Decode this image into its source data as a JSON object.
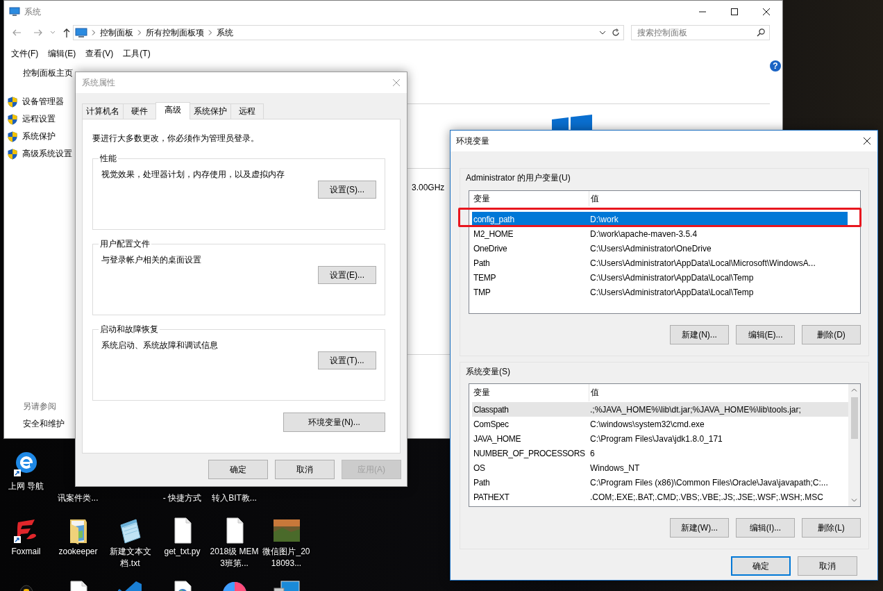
{
  "control_panel": {
    "title": "系统",
    "active": false,
    "breadcrumb": [
      "控制面板",
      "所有控制面板项",
      "系统"
    ],
    "search": {
      "placeholder": "搜索控制面板"
    },
    "menu": [
      "文件(F)",
      "编辑(E)",
      "查看(V)",
      "工具(T)"
    ],
    "help_button": "?",
    "home_link": "控制面板主页",
    "tasks": [
      "设备管理器",
      "远程设置",
      "系统保护",
      "高级系统设置"
    ],
    "see_also": {
      "heading": "另请参阅",
      "links": [
        "安全和维护"
      ]
    },
    "processor_speed": "3.00GHz"
  },
  "desktop": {
    "rows": [
      {
        "icons": [
          {
            "kind": "ie",
            "label": "上网 导航"
          },
          {
            "kind": "covered",
            "label": "讯案件类..."
          },
          {
            "kind": "covered"
          },
          {
            "kind": "covered",
            "label": "- 快捷方式"
          },
          {
            "kind": "covered",
            "label": "转入BIT教..."
          }
        ]
      },
      {
        "icons": [
          {
            "kind": "foxmail",
            "label": "Foxmail"
          },
          {
            "kind": "folder",
            "label": "zookeeper"
          },
          {
            "kind": "notepad",
            "label": "新建文本文档.txt"
          },
          {
            "kind": "file",
            "label": "get_txt.py"
          },
          {
            "kind": "file",
            "label": "2018级 MEM3班第..."
          },
          {
            "kind": "photo",
            "label": "微信图片_2018093..."
          }
        ]
      },
      {
        "icons": [
          {
            "kind": "qq"
          },
          {
            "kind": "file"
          },
          {
            "kind": "vscode"
          },
          {
            "kind": "html"
          },
          {
            "kind": "circle"
          },
          {
            "kind": "computer"
          }
        ]
      }
    ]
  },
  "system_properties": {
    "title": "系统属性",
    "active": false,
    "tabs": [
      {
        "label": "计算机名",
        "selected": false
      },
      {
        "label": "硬件",
        "selected": false
      },
      {
        "label": "高级",
        "selected": true
      },
      {
        "label": "系统保护",
        "selected": false
      },
      {
        "label": "远程",
        "selected": false
      }
    ],
    "notice": "要进行大多数更改，你必须作为管理员登录。",
    "groups": [
      {
        "title": "性能",
        "description": "视觉效果，处理器计划，内存使用，以及虚拟内存",
        "button": "设置(S)..."
      },
      {
        "title": "用户配置文件",
        "description": "与登录帐户相关的桌面设置",
        "button": "设置(E)..."
      },
      {
        "title": "启动和故障恢复",
        "description": "系统启动、系统故障和调试信息",
        "button": "设置(T)..."
      }
    ],
    "env_button": "环境变量(N)...",
    "buttons": [
      {
        "label": "确定",
        "disabled": false
      },
      {
        "label": "取消",
        "disabled": false
      },
      {
        "label": "应用(A)",
        "disabled": true
      }
    ]
  },
  "environment_variables": {
    "title": "环境变量",
    "active": true,
    "user_variables": {
      "title": "Administrator 的用户变量(U)",
      "columns": [
        "变量",
        "值"
      ],
      "rows": [
        {
          "name": "config_path",
          "value": "D:\\work",
          "selected": true
        },
        {
          "name": "M2_HOME",
          "value": "D:\\work\\apache-maven-3.5.4",
          "selected": false
        },
        {
          "name": "OneDrive",
          "value": "C:\\Users\\Administrator\\OneDrive",
          "selected": false
        },
        {
          "name": "Path",
          "value": "C:\\Users\\Administrator\\AppData\\Local\\Microsoft\\WindowsA...",
          "selected": false
        },
        {
          "name": "TEMP",
          "value": "C:\\Users\\Administrator\\AppData\\Local\\Temp",
          "selected": false
        },
        {
          "name": "TMP",
          "value": "C:\\Users\\Administrator\\AppData\\Local\\Temp",
          "selected": false
        }
      ],
      "buttons": [
        "新建(N)...",
        "编辑(E)...",
        "删除(D)"
      ]
    },
    "system_variables": {
      "title": "系统变量(S)",
      "columns": [
        "变量",
        "值"
      ],
      "rows": [
        {
          "name": "Classpath",
          "value": ".;%JAVA_HOME%\\lib\\dt.jar;%JAVA_HOME%\\lib\\tools.jar;",
          "selected": false,
          "highlighted": true
        },
        {
          "name": "ComSpec",
          "value": "C:\\windows\\system32\\cmd.exe",
          "selected": false,
          "highlighted": false
        },
        {
          "name": "JAVA_HOME",
          "value": "C:\\Program Files\\Java\\jdk1.8.0_171",
          "selected": false,
          "highlighted": false
        },
        {
          "name": "NUMBER_OF_PROCESSORS",
          "value": "6",
          "selected": false,
          "highlighted": false
        },
        {
          "name": "OS",
          "value": "Windows_NT",
          "selected": false,
          "highlighted": false
        },
        {
          "name": "Path",
          "value": "C:\\Program Files (x86)\\Common Files\\Oracle\\Java\\javapath;C:...",
          "selected": false,
          "highlighted": false
        },
        {
          "name": "PATHEXT",
          "value": ".COM;.EXE;.BAT;.CMD;.VBS;.VBE;.JS;.JSE;.WSF;.WSH;.MSC",
          "selected": false,
          "highlighted": false
        }
      ],
      "buttons": [
        "新建(W)...",
        "编辑(I)...",
        "删除(L)"
      ]
    },
    "buttons": [
      {
        "label": "确定",
        "default": true
      },
      {
        "label": "取消",
        "default": false
      }
    ]
  }
}
